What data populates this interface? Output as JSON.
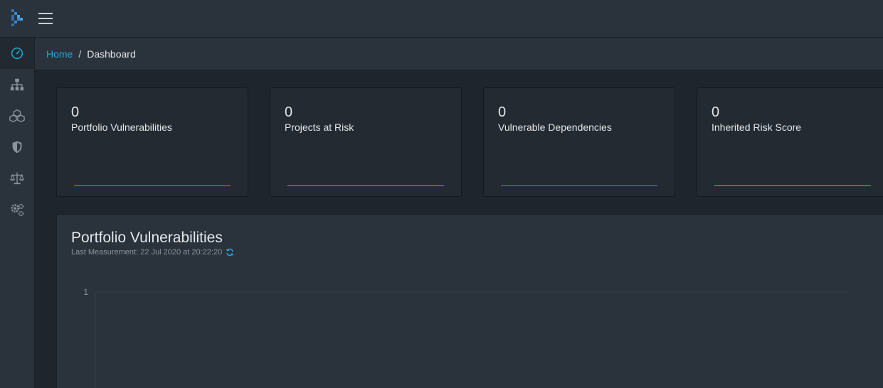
{
  "header": {
    "logo_icon": "dependency-track-logo-icon",
    "menu_icon": "hamburger-menu-icon"
  },
  "sidebar": {
    "items": [
      {
        "name": "dashboard",
        "icon": "speedometer-icon",
        "active": true
      },
      {
        "name": "projects",
        "icon": "sitemap-icon",
        "active": false
      },
      {
        "name": "components",
        "icon": "cubes-icon",
        "active": false
      },
      {
        "name": "vulnerabilities",
        "icon": "shield-icon",
        "active": false
      },
      {
        "name": "policy",
        "icon": "balance-scale-icon",
        "active": false
      },
      {
        "name": "administration",
        "icon": "cogs-icon",
        "active": false
      }
    ]
  },
  "breadcrumb": {
    "home": "Home",
    "separator": "/",
    "current": "Dashboard"
  },
  "cards": [
    {
      "value": "0",
      "label": "Portfolio Vulnerabilities",
      "color": "#20a8d8"
    },
    {
      "value": "0",
      "label": "Projects at Risk",
      "color": "#a86fe0"
    },
    {
      "value": "0",
      "label": "Vulnerable Dependencies",
      "color": "#6a6fe0"
    },
    {
      "value": "0",
      "label": "Inherited Risk Score",
      "color": "#f86c6b"
    }
  ],
  "panel": {
    "title": "Portfolio Vulnerabilities",
    "subtitle": "Last Measurement: 22 Jul 2020 at 20:22:20",
    "refresh_icon": "refresh-icon"
  },
  "chart_data": {
    "type": "line",
    "series": [],
    "yticks": [
      "1"
    ],
    "ylim": [
      0,
      1
    ],
    "grid": true
  },
  "colors": {
    "accent": "#20a8d8",
    "background": "#1f252c",
    "panel": "#2a323b",
    "card": "#242a31"
  }
}
